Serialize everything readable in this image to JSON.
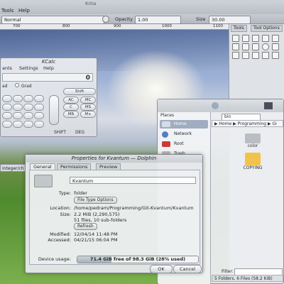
{
  "krita": {
    "menu": [
      "Tools",
      "Help"
    ],
    "window_title": "Krita",
    "blend_mode": "Normal",
    "opacity_label": "Opacity",
    "opacity_value": "1.00",
    "size_label": "Size",
    "size_value": "30.00",
    "ruler": [
      "700",
      "800",
      "900",
      "1000",
      "1100"
    ],
    "panel_tabs": [
      "Tools",
      "Tool Options"
    ],
    "integer_field": "integer/ch"
  },
  "kcalc": {
    "title": "KCalc",
    "menu": [
      "ants",
      "Settings",
      "Help"
    ],
    "display": "0",
    "modes": [
      "ad",
      "Grad"
    ],
    "buttons": [
      "Shift",
      "AC",
      "MC",
      "MS",
      "C",
      "MR",
      "M+",
      "SHIFT",
      "DEG"
    ]
  },
  "dolphin": {
    "places_header": "Places",
    "places": [
      "Home",
      "Network",
      "Root",
      "Trash"
    ],
    "search": "bin",
    "breadcrumb": "▶ Home ▶ Programming ▶ Gi",
    "files": [
      {
        "name": "color"
      },
      {
        "name": "COPYING"
      }
    ],
    "filter_label": "Filter:",
    "status": "5 Folders, 6 Files (58.2 KiB)"
  },
  "properties": {
    "title": "Properties for Kvantum — Dolphin",
    "tabs": [
      "General",
      "Permissions",
      "Preview"
    ],
    "name": "Kvantum",
    "type_label": "Type:",
    "type_value": "folder",
    "file_type_options": "File Type Options",
    "location_label": "Location:",
    "location_value": "/home/pedram/Programming/Git-Kvantum/Kvantum",
    "size_label": "Size:",
    "size_value": "2.2 MiB (2,290,575)",
    "size_detail": "51 files, 10 sub-folders",
    "refresh": "Refresh",
    "modified_label": "Modified:",
    "modified_value": "12/04/14 11:48 PM",
    "accessed_label": "Accessed:",
    "accessed_value": "04/21/15 06:04 PM",
    "usage_label": "Device usage:",
    "usage_text": "71.4 GiB free of 98.3 GiB (28% used)",
    "usage_fraction": 0.28,
    "ok": "OK",
    "cancel": "Cancel"
  }
}
